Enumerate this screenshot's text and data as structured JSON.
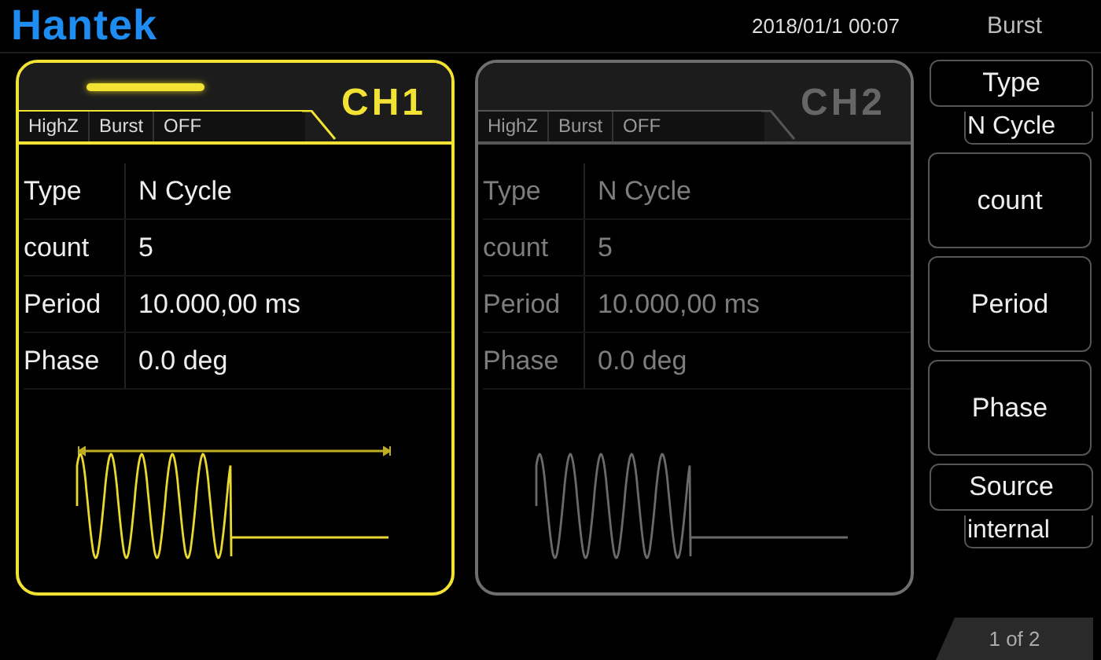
{
  "header": {
    "logo": "Hantek",
    "datetime": "2018/01/1 00:07"
  },
  "channels": [
    {
      "name": "CH1",
      "selected": true,
      "status": [
        "HighZ",
        "Burst",
        "OFF"
      ],
      "params": [
        {
          "label": "Type",
          "value": "N Cycle"
        },
        {
          "label": "count",
          "value": "5"
        },
        {
          "label": "Period",
          "value": "10.000,00 ms"
        },
        {
          "label": "Phase",
          "value": "0.0 deg"
        }
      ]
    },
    {
      "name": "CH2",
      "selected": false,
      "status": [
        "HighZ",
        "Burst",
        "OFF"
      ],
      "params": [
        {
          "label": "Type",
          "value": "N Cycle"
        },
        {
          "label": "count",
          "value": "5"
        },
        {
          "label": "Period",
          "value": "10.000,00 ms"
        },
        {
          "label": "Phase",
          "value": "0.0 deg"
        }
      ]
    }
  ],
  "menu": {
    "title": "Burst",
    "items": [
      {
        "kind": "option",
        "label": "Type",
        "value": "N Cycle"
      },
      {
        "kind": "button",
        "label": "count"
      },
      {
        "kind": "button",
        "label": "Period"
      },
      {
        "kind": "button",
        "label": "Phase"
      },
      {
        "kind": "option",
        "label": "Source",
        "value": "internal"
      }
    ],
    "page": "1 of 2"
  }
}
